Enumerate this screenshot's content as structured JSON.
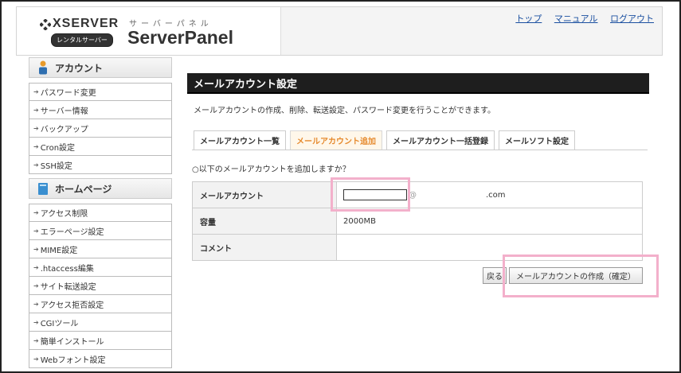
{
  "header": {
    "brand": "XSERVER",
    "badge": "レンタルサーバー",
    "kana": "サーバーパネル",
    "product": "ServerPanel",
    "links": [
      "トップ",
      "マニュアル",
      "ログアウト"
    ]
  },
  "sidebar": {
    "sections": [
      {
        "title": "アカウント",
        "icon": "person-icon",
        "items": [
          "パスワード変更",
          "サーバー情報",
          "バックアップ",
          "Cron設定",
          "SSH設定"
        ]
      },
      {
        "title": "ホームページ",
        "icon": "book-icon",
        "items": [
          "アクセス制限",
          "エラーページ設定",
          "MIME設定",
          ".htaccess編集",
          "サイト転送設定",
          "アクセス拒否設定",
          "CGIツール",
          "簡単インストール",
          "Webフォント設定"
        ]
      }
    ]
  },
  "main": {
    "title": "メールアカウント設定",
    "description": "メールアカウントの作成、削除、転送設定、パスワード変更を行うことができます。",
    "tabs": [
      "メールアカウント一覧",
      "メールアカウント追加",
      "メールアカウント一括登録",
      "メールソフト設定"
    ],
    "active_tab": 1,
    "question": "○以下のメールアカウントを追加しますか？",
    "rows": [
      {
        "label": "メールアカウント",
        "value": "@",
        "domain_suffix": ".com"
      },
      {
        "label": "容量",
        "value": "2000MB"
      },
      {
        "label": "コメント",
        "value": ""
      }
    ],
    "back_button": "戻る",
    "create_button": "メールアカウントの作成（確定）"
  },
  "colors": {
    "highlight": "#f3b0cb",
    "active_tab": "#e68a2e",
    "title_bar": "#1e1e1e",
    "link": "#1a4fa0"
  }
}
